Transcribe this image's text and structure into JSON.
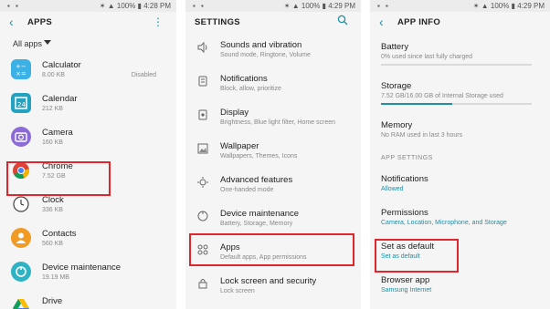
{
  "statusbar": {
    "p1": {
      "battery": "100%",
      "time": "4:28 PM"
    },
    "p2": {
      "battery": "100%",
      "time": "4:29 PM"
    },
    "p3": {
      "battery": "100%",
      "time": "4:29 PM"
    }
  },
  "apps_screen": {
    "title": "APPS",
    "filter_label": "All apps",
    "items": [
      {
        "name": "Calculator",
        "size": "8.00 KB",
        "status": "Disabled",
        "icon": "calculator-icon",
        "color": "#3bb1e6"
      },
      {
        "name": "Calendar",
        "size": "212 KB",
        "status": "",
        "icon": "calendar-icon",
        "color": "#24a2c0"
      },
      {
        "name": "Camera",
        "size": "160 KB",
        "status": "",
        "icon": "camera-icon",
        "color": "#8c6ad8"
      },
      {
        "name": "Chrome",
        "size": "7.52 GB",
        "status": "",
        "icon": "chrome-icon",
        "color": "#ffffff"
      },
      {
        "name": "Clock",
        "size": "336 KB",
        "status": "",
        "icon": "clock-icon",
        "color": "#ffffff"
      },
      {
        "name": "Contacts",
        "size": "560 KB",
        "status": "",
        "icon": "contacts-icon",
        "color": "#f29b24"
      },
      {
        "name": "Device maintenance",
        "size": "19.19 MB",
        "status": "",
        "icon": "device-maintenance-icon",
        "color": "#2fb2c4"
      },
      {
        "name": "Drive",
        "size": "",
        "status": "",
        "icon": "drive-icon",
        "color": "#ffffff"
      }
    ]
  },
  "settings_screen": {
    "title": "SETTINGS",
    "items": [
      {
        "name": "Sounds and vibration",
        "sub": "Sound mode, Ringtone, Volume",
        "icon": "speaker-icon"
      },
      {
        "name": "Notifications",
        "sub": "Block, allow, prioritize",
        "icon": "notification-icon"
      },
      {
        "name": "Display",
        "sub": "Brightness, Blue light filter, Home screen",
        "icon": "display-icon"
      },
      {
        "name": "Wallpaper",
        "sub": "Wallpapers, Themes, Icons",
        "icon": "wallpaper-icon"
      },
      {
        "name": "Advanced features",
        "sub": "One-handed mode",
        "icon": "advanced-features-icon"
      },
      {
        "name": "Device maintenance",
        "sub": "Battery, Storage, Memory",
        "icon": "device-maintenance-icon"
      },
      {
        "name": "Apps",
        "sub": "Default apps, App permissions",
        "icon": "apps-icon"
      },
      {
        "name": "Lock screen and security",
        "sub": "Lock screen",
        "icon": "lock-icon"
      }
    ]
  },
  "appinfo_screen": {
    "title": "APP INFO",
    "battery": {
      "name": "Battery",
      "sub": "0% used since last fully charged",
      "usage_fraction": 0.0
    },
    "storage": {
      "name": "Storage",
      "sub": "7.52 GB/16.00 GB of Internal Storage used",
      "usage_fraction": 0.47
    },
    "memory": {
      "name": "Memory",
      "sub": "No RAM used in last 3 hours"
    },
    "section_label": "APP SETTINGS",
    "notifications": {
      "name": "Notifications",
      "sub": "Allowed"
    },
    "permissions": {
      "name": "Permissions",
      "sub": "Camera, Location, Microphone, and Storage"
    },
    "set_default": {
      "name": "Set as default",
      "sub": "Set as default"
    },
    "browser_app": {
      "name": "Browser app",
      "sub": "Samsung Internet"
    }
  },
  "colors": {
    "accent": "#1e8fa5",
    "highlight": "#e0262d"
  }
}
